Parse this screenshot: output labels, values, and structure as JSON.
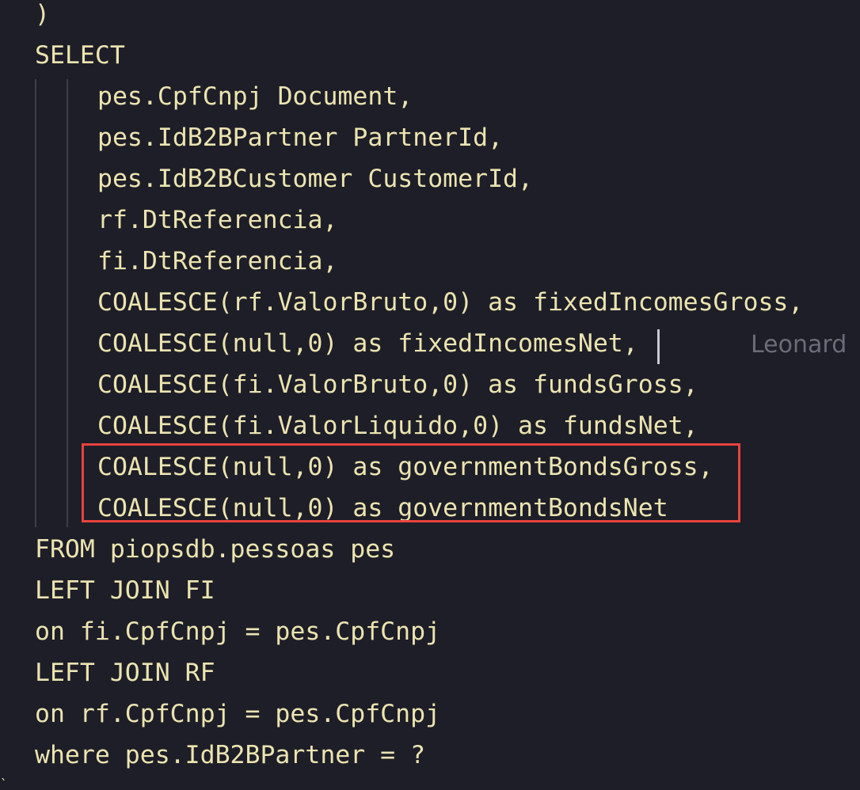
{
  "editor": {
    "lines": [
      ")",
      "SELECT",
      "pes.CpfCnpj Document,",
      "pes.IdB2BPartner PartnerId,",
      "pes.IdB2BCustomer CustomerId,",
      "rf.DtReferencia,",
      "fi.DtReferencia,",
      "COALESCE(rf.ValorBruto,0) as fixedIncomesGross,",
      "COALESCE(null,0) as fixedIncomesNet,",
      "COALESCE(fi.ValorBruto,0) as fundsGross,",
      "COALESCE(fi.ValorLiquido,0) as fundsNet,",
      "COALESCE(null,0) as governmentBondsGross,",
      "COALESCE(null,0) as governmentBondsNet",
      "FROM piopsdb.pessoas pes",
      "LEFT JOIN FI",
      "on fi.CpfCnpj = pes.CpfCnpj",
      "LEFT JOIN RF",
      "on rf.CpfCnpj = pes.CpfCnpj",
      "where pes.IdB2BPartner = ?"
    ],
    "inline_blame": "Leonard",
    "trailing_char": "`"
  },
  "colors": {
    "background": "#1e1e28",
    "code_text": "#ece4b0",
    "indent_guide": "#3e3e4a",
    "blame_text": "#6c6c78",
    "highlight_border": "#e8433c",
    "cursor": "#c8c8d0"
  }
}
